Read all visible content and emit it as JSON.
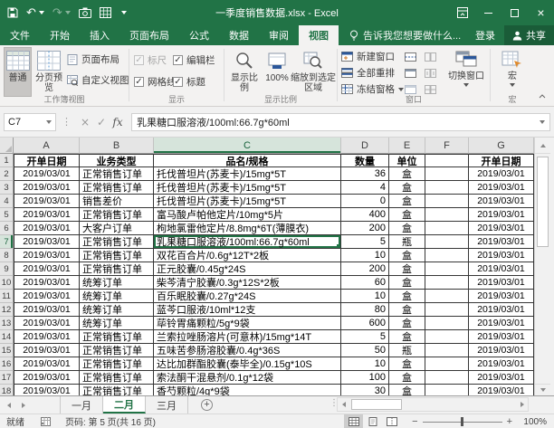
{
  "titlebar": {
    "title": "一季度销售数据.xlsx - Excel",
    "quick_access_icons": [
      "save",
      "undo",
      "redo",
      "camera",
      "worksheet"
    ],
    "window_controls": [
      "ribbon-display-options",
      "minimize",
      "maximize",
      "close"
    ]
  },
  "ribbon_tabs": {
    "items": [
      "文件",
      "开始",
      "插入",
      "页面布局",
      "公式",
      "数据",
      "审阅",
      "视图"
    ],
    "active": "视图",
    "tell_me": "告诉我您想要做什么...",
    "sign_in": "登录",
    "share": "共享"
  },
  "ribbon": {
    "workbook_views": {
      "label": "工作簿视图",
      "normal": "普通",
      "page_break_preview": "分页预览",
      "page_layout": "页面布局",
      "custom_views": "自定义视图"
    },
    "show": {
      "label": "显示",
      "items": [
        {
          "label": "标尺",
          "checked": true,
          "enabled": false
        },
        {
          "label": "编辑栏",
          "checked": true,
          "enabled": true
        },
        {
          "label": "网格线",
          "checked": true,
          "enabled": true
        },
        {
          "label": "标题",
          "checked": true,
          "enabled": true
        }
      ]
    },
    "zoom": {
      "label": "显示比例",
      "zoom": "显示比例",
      "hundred": "100%",
      "zoom_to_selection": "缩放到选定区域"
    },
    "window": {
      "label": "窗口",
      "new_window": "新建窗口",
      "arrange_all": "全部重排",
      "freeze_panes": "冻结窗格",
      "switch_windows": "切换窗口"
    },
    "macros": {
      "label": "宏",
      "button": "宏"
    }
  },
  "formula_bar": {
    "name_box": "C7",
    "formula": "乳果糖口服溶液/100ml:66.7g*60ml"
  },
  "grid": {
    "columns": [
      "A",
      "B",
      "C",
      "D",
      "E",
      "F",
      "G"
    ],
    "header_row": [
      "开单日期",
      "业务类型",
      "品名/规格",
      "数量",
      "单位",
      "",
      "开单日期"
    ],
    "rows": [
      [
        "2019/03/01",
        "正常销售订单",
        "托伐普坦片(苏麦卡)/15mg*5T",
        "36",
        "盒",
        "",
        "2019/03/01"
      ],
      [
        "2019/03/01",
        "正常销售订单",
        "托伐普坦片(苏麦卡)/15mg*5T",
        "4",
        "盒",
        "",
        "2019/03/01"
      ],
      [
        "2019/03/01",
        "销售差价",
        "托伐普坦片(苏麦卡)/15mg*5T",
        "0",
        "盒",
        "",
        "2019/03/01"
      ],
      [
        "2019/03/01",
        "正常销售订单",
        "富马酸卢帕他定片/10mg*5片",
        "400",
        "盒",
        "",
        "2019/03/01"
      ],
      [
        "2019/03/01",
        "大客户订单",
        "枸地氯雷他定片/8.8mg*6T(薄膜衣)",
        "200",
        "盒",
        "",
        "2019/03/01"
      ],
      [
        "2019/03/01",
        "正常销售订单",
        "乳果糖口服溶液/100ml:66.7g*60ml",
        "5",
        "瓶",
        "",
        "2019/03/01"
      ],
      [
        "2019/03/01",
        "正常销售订单",
        "双花百合片/0.6g*12T*2板",
        "10",
        "盒",
        "",
        "2019/03/01"
      ],
      [
        "2019/03/01",
        "正常销售订单",
        "正元胶囊/0.45g*24S",
        "200",
        "盒",
        "",
        "2019/03/01"
      ],
      [
        "2019/03/01",
        "统筹订单",
        "柴芩清宁胶囊/0.3g*12S*2板",
        "60",
        "盒",
        "",
        "2019/03/01"
      ],
      [
        "2019/03/01",
        "统筹订单",
        "百乐眠胶囊/0.27g*24S",
        "10",
        "盒",
        "",
        "2019/03/01"
      ],
      [
        "2019/03/01",
        "统筹订单",
        "蓝芩口服液/10ml*12支",
        "80",
        "盒",
        "",
        "2019/03/01"
      ],
      [
        "2019/03/01",
        "统筹订单",
        "荜铃胃痛颗粒/5g*9袋",
        "600",
        "盒",
        "",
        "2019/03/01"
      ],
      [
        "2019/03/01",
        "正常销售订单",
        "兰索拉唑肠溶片(可意林)/15mg*14T",
        "5",
        "盒",
        "",
        "2019/03/01"
      ],
      [
        "2019/03/01",
        "正常销售订单",
        "五味苦参肠溶胶囊/0.4g*36S",
        "50",
        "瓶",
        "",
        "2019/03/01"
      ],
      [
        "2019/03/01",
        "正常销售订单",
        "达比加群酯胶囊(泰毕全)/0.15g*10S",
        "10",
        "盒",
        "",
        "2019/03/01"
      ],
      [
        "2019/03/01",
        "正常销售订单",
        "索法酮干混悬剂/0.1g*12袋",
        "100",
        "盒",
        "",
        "2019/03/01"
      ],
      [
        "2019/03/01",
        "正常销售订单",
        "香芍颗粒/4g*9袋",
        "30",
        "盒",
        "",
        "2019/03/01"
      ]
    ]
  },
  "selection": {
    "cell": "C7",
    "row": 7,
    "column": "C"
  },
  "sheet_tabs": {
    "tabs": [
      "一月",
      "二月",
      "三月"
    ],
    "active": "二月"
  },
  "status_bar": {
    "mode": "就绪",
    "page_info": "页码: 第 5 页(共 16 页)",
    "zoom_level": "100%"
  },
  "colors": {
    "accent": "#217346",
    "ribbon_bg": "#f3f2f1",
    "header_bg": "#e5e5e5"
  }
}
